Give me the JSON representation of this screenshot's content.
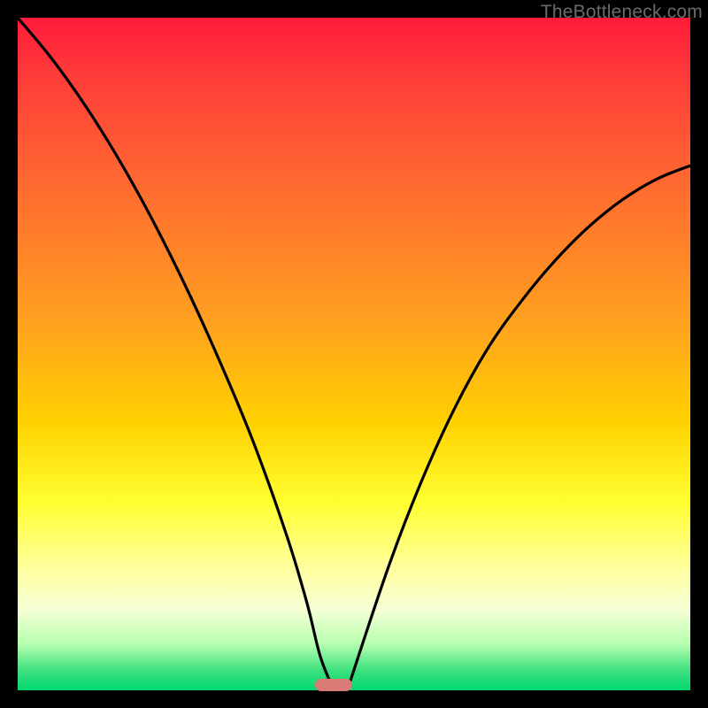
{
  "watermark": "TheBottleneck.com",
  "colors": {
    "frame_bg": "#000000",
    "curve": "#000000",
    "marker": "#d97a77"
  },
  "chart_data": {
    "type": "line",
    "title": "",
    "xlabel": "",
    "ylabel": "",
    "xlim": [
      0,
      100
    ],
    "ylim": [
      0,
      100
    ],
    "grid": false,
    "x": [
      0,
      5,
      10,
      15,
      20,
      25,
      30,
      35,
      40,
      43,
      45,
      47,
      49,
      55,
      60,
      65,
      70,
      75,
      80,
      85,
      90,
      95,
      100
    ],
    "series": [
      {
        "name": "left-curve",
        "values": [
          100,
          94,
          87,
          79,
          70,
          60,
          49,
          37,
          23,
          13,
          5,
          0,
          null,
          null,
          null,
          null,
          null,
          null,
          null,
          null,
          null,
          null,
          null
        ]
      },
      {
        "name": "right-curve",
        "values": [
          null,
          null,
          null,
          null,
          null,
          null,
          null,
          null,
          null,
          null,
          null,
          null,
          0,
          18,
          31,
          42,
          51,
          58,
          64,
          69,
          73,
          76,
          78
        ]
      }
    ],
    "marker": {
      "x_center": 47,
      "width_pct": 5.5
    }
  }
}
